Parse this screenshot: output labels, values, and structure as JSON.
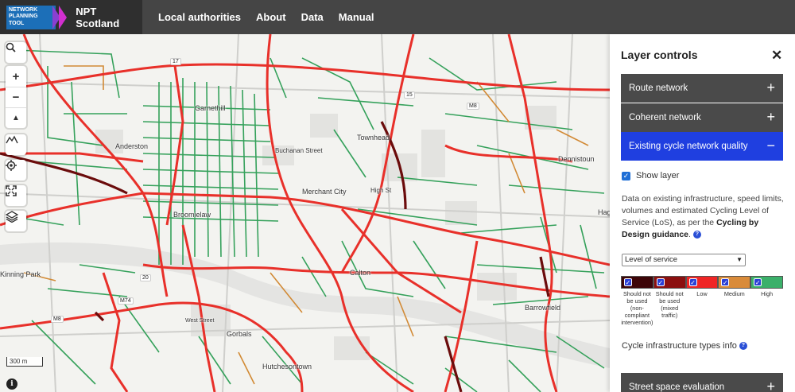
{
  "header": {
    "logo_text": [
      "NETWORK",
      "PLANNING",
      "TOOL"
    ],
    "brand": "NPT Scotland",
    "nav": [
      "Local authorities",
      "About",
      "Data",
      "Manual"
    ]
  },
  "map": {
    "places": [
      "Garnethill",
      "Anderston",
      "Townhead",
      "Dennistoun",
      "Merchant City",
      "Broomielaw",
      "Calton",
      "Barrowfield",
      "Gorbals",
      "Hutchesontown",
      "Kinning Park",
      "Buchanan Street",
      "High St",
      "West Street",
      "Hag"
    ],
    "road_labels": [
      "M8",
      "M8",
      "M74",
      "17",
      "15",
      "20"
    ],
    "scale_label": "300 m",
    "controls": {
      "search_icon": "search-icon",
      "zoom_in": "+",
      "zoom_out": "−",
      "compass": "▲"
    }
  },
  "panel": {
    "title": "Layer controls",
    "close": "✕",
    "sections": [
      {
        "label": "Route network",
        "sign": "+"
      },
      {
        "label": "Coherent network",
        "sign": "+"
      },
      {
        "label": "Existing cycle network quality",
        "sign": "−"
      }
    ],
    "show_layer": "Show layer",
    "desc_before": "Data on existing infrastructure, speed limits, volumes and estimated Cycling Level of Service (LoS), as per the ",
    "desc_bold": "Cycling by Design guidance",
    "desc_after": ".",
    "select_value": "Level of service",
    "legend": [
      {
        "label": "Should not be used (non-compliant intervention)",
        "color": "#3d0508"
      },
      {
        "label": "Should not be used (mixed traffic)",
        "color": "#8b1010"
      },
      {
        "label": "Low",
        "color": "#ef2525"
      },
      {
        "label": "Medium",
        "color": "#d98b3a"
      },
      {
        "label": "High",
        "color": "#3bb06a"
      }
    ],
    "infra_label": "Cycle infrastructure types info",
    "bottom_section": {
      "label": "Street space evaluation",
      "sign": "+"
    }
  },
  "colors": {
    "header": "#454545",
    "active": "#1f3fe0",
    "red_route": "#e8302a",
    "green_route": "#35a15b",
    "orange_route": "#d28a35"
  }
}
